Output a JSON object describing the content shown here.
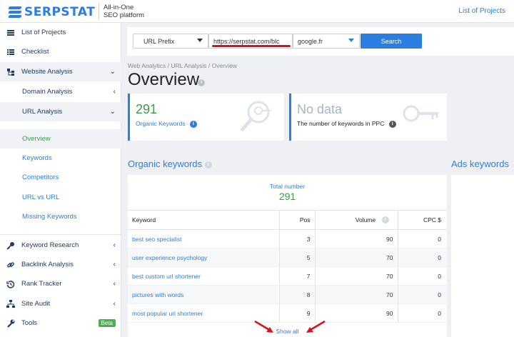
{
  "header": {
    "brand": "SERPSTAT",
    "tagline_line1": "All-in-One",
    "tagline_line2": "SEO platform",
    "list_projects_link": "List of Projects"
  },
  "sidebar": {
    "items": [
      {
        "label": "List of Projects",
        "icon": "menu-icon"
      },
      {
        "label": "Checklist",
        "icon": "list-icon"
      },
      {
        "label": "Website Analysis",
        "icon": "sitemap-icon"
      },
      {
        "label": "Domain Analysis"
      },
      {
        "label": "URL Analysis"
      },
      {
        "label": "Overview"
      },
      {
        "label": "Keywords"
      },
      {
        "label": "Competitors"
      },
      {
        "label": "URL vs URL"
      },
      {
        "label": "Missing Keywords"
      },
      {
        "label": "Keyword Research",
        "icon": "key-icon"
      },
      {
        "label": "Backlink Analysis",
        "icon": "link-icon"
      },
      {
        "label": "Rank Tracker",
        "icon": "history-icon"
      },
      {
        "label": "Site Audit",
        "icon": "network-icon"
      },
      {
        "label": "Tools",
        "icon": "wrench-icon",
        "badge": "Beta"
      }
    ]
  },
  "search": {
    "mode": "URL Prefix",
    "url_value": "https://serpstat.com/blc",
    "database": "google.fr",
    "button": "Search"
  },
  "breadcrumb": "Web Analytics / URL Analysis / Overview",
  "page_title": "Overview",
  "cards": [
    {
      "value": "291",
      "label": "Organic Keywords"
    },
    {
      "value": "No data",
      "label": "The number of keywords in PPC"
    }
  ],
  "organic": {
    "title": "Organic keywords",
    "total_label": "Total number",
    "total_value": "291",
    "columns": {
      "keyword": "Keyword",
      "pos": "Pos",
      "volume": "Volume",
      "cpc": "CPC $"
    },
    "rows": [
      {
        "keyword": "best seo specialist",
        "pos": "3",
        "volume": "90",
        "cpc": "0"
      },
      {
        "keyword": "user experience psychology",
        "pos": "5",
        "volume": "70",
        "cpc": "0"
      },
      {
        "keyword": "best custom url shortener",
        "pos": "7",
        "volume": "70",
        "cpc": "0"
      },
      {
        "keyword": "pictures with words",
        "pos": "8",
        "volume": "70",
        "cpc": "0"
      },
      {
        "keyword": "most popular url shortener",
        "pos": "9",
        "volume": "90",
        "cpc": "0"
      }
    ],
    "show_all": "Show all"
  },
  "ads": {
    "title": "Ads keywords"
  },
  "colors": {
    "accent": "#2b7de1",
    "positive": "#3d9c47",
    "annotation": "#d6121e"
  }
}
